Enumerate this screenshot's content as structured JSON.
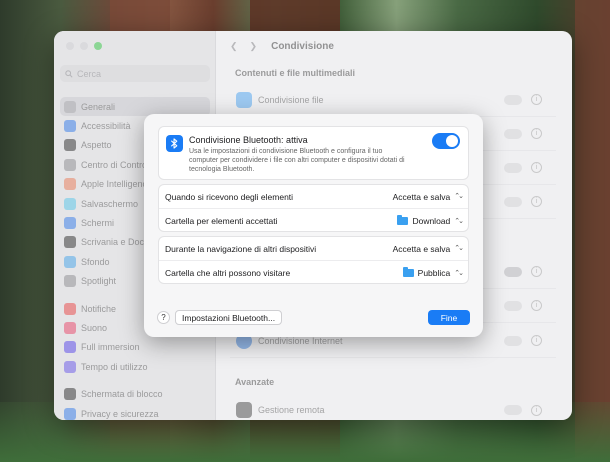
{
  "window": {
    "title": "Condivisione",
    "search_placeholder": "Cerca",
    "sidebar": [
      {
        "label": "Generali",
        "color": "#9a9a9e",
        "active": true
      },
      {
        "label": "Accessibilità",
        "color": "#3a7be0"
      },
      {
        "label": "Aspetto",
        "color": "#333333"
      },
      {
        "label": "Centro di Controllo",
        "color": "#8a8a8e"
      },
      {
        "label": "Apple Intelligence",
        "color": "#e07a5a"
      },
      {
        "label": "Salvaschermo",
        "color": "#5ac0e0"
      },
      {
        "label": "Schermi",
        "color": "#3a7be0"
      },
      {
        "label": "Scrivania e Dock",
        "color": "#333333"
      },
      {
        "label": "Sfondo",
        "color": "#4aa0e0"
      },
      {
        "label": "Spotlight",
        "color": "#8a8a8e"
      },
      {
        "label": "Notifiche",
        "color": "#e04a4a",
        "gap": true
      },
      {
        "label": "Suono",
        "color": "#e04a6a"
      },
      {
        "label": "Full immersion",
        "color": "#5a4ae0"
      },
      {
        "label": "Tempo di utilizzo",
        "color": "#6a5ae0"
      },
      {
        "label": "Schermata di blocco",
        "color": "#333333",
        "gap": true
      },
      {
        "label": "Privacy e sicurezza",
        "color": "#3a7be0"
      }
    ],
    "section_media": "Contenuti e file multimediali",
    "row_file_sharing": "Condivisione file",
    "row_internet_sharing": "Condivisione Internet",
    "section_advanced": "Avanzate",
    "row_remote_management": "Gestione remota"
  },
  "dialog": {
    "bluetooth_title": "Condivisione Bluetooth: attiva",
    "bluetooth_desc": "Usa le impostazioni di condivisione Bluetooth e configura il tuo computer per condividere i file con altri computer e dispositivi dotati di tecnologia Bluetooth.",
    "bluetooth_enabled": true,
    "settings_group1": [
      {
        "label": "Quando si ricevono degli elementi",
        "value": "Accetta e salva",
        "folder": false
      },
      {
        "label": "Cartella per elementi accettati",
        "value": "Download",
        "folder": true
      }
    ],
    "settings_group2": [
      {
        "label": "Durante la navigazione di altri dispositivi",
        "value": "Accetta e salva",
        "folder": false
      },
      {
        "label": "Cartella che altri possono visitare",
        "value": "Pubblica",
        "folder": true
      }
    ],
    "help_label": "?",
    "bt_settings_button": "Impostazioni Bluetooth...",
    "done_button": "Fine"
  },
  "colors": {
    "accent": "#1a7cf5"
  }
}
